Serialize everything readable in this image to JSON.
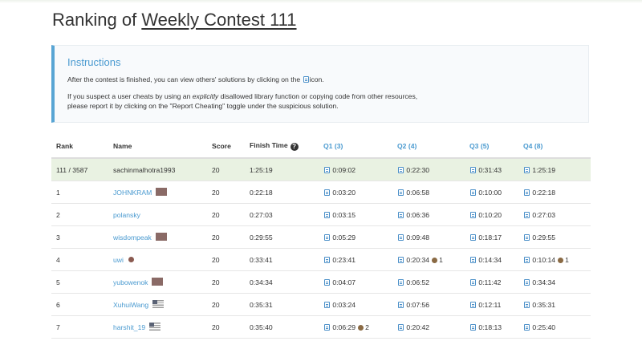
{
  "page": {
    "title_prefix": "Ranking of",
    "contest_name": "Weekly Contest 111"
  },
  "instructions": {
    "heading": "Instructions",
    "line1_a": "After the contest is finished, you can view others' solutions by clicking on the",
    "line1_b": "icon.",
    "line2_a": "If you suspect a user cheats by using an",
    "line2_em": "explicitly",
    "line2_b": "disallowed library function or copying code from other resources,",
    "line3": "please report it by clicking on the \"Report Cheating\" toggle under the suspicious solution."
  },
  "table": {
    "headers": {
      "rank": "Rank",
      "name": "Name",
      "score": "Score",
      "finish": "Finish Time",
      "q1": "Q1 (3)",
      "q2": "Q2 (4)",
      "q3": "Q3 (5)",
      "q4": "Q4 (8)"
    },
    "info_icon": "info-icon",
    "rows": [
      {
        "rank": "111 / 3587",
        "name": "sachinmalhotra1993",
        "flag": "",
        "score": "20",
        "finish": "1:25:19",
        "q1": "0:09:02",
        "q1_bugs": "",
        "q2": "0:22:30",
        "q2_bugs": "",
        "q3": "0:31:43",
        "q3_bugs": "",
        "q4": "1:25:19",
        "q4_bugs": ""
      },
      {
        "rank": "1",
        "name": "JOHNKRAM",
        "flag": "flag-icon",
        "score": "20",
        "finish": "0:22:18",
        "q1": "0:03:20",
        "q1_bugs": "",
        "q2": "0:06:58",
        "q2_bugs": "",
        "q3": "0:10:00",
        "q3_bugs": "",
        "q4": "0:22:18",
        "q4_bugs": ""
      },
      {
        "rank": "2",
        "name": "polansky",
        "flag": "",
        "score": "20",
        "finish": "0:27:03",
        "q1": "0:03:15",
        "q1_bugs": "",
        "q2": "0:06:36",
        "q2_bugs": "",
        "q3": "0:10:20",
        "q3_bugs": "",
        "q4": "0:27:03",
        "q4_bugs": ""
      },
      {
        "rank": "3",
        "name": "wisdompeak",
        "flag": "flag-icon",
        "score": "20",
        "finish": "0:29:55",
        "q1": "0:05:29",
        "q1_bugs": "",
        "q2": "0:09:48",
        "q2_bugs": "",
        "q3": "0:18:17",
        "q3_bugs": "",
        "q4": "0:29:55",
        "q4_bugs": ""
      },
      {
        "rank": "4",
        "name": "uwi",
        "flag": "dot-flag-icon",
        "score": "20",
        "finish": "0:33:41",
        "q1": "0:23:41",
        "q1_bugs": "",
        "q2": "0:20:34",
        "q2_bugs": "1",
        "q3": "0:14:34",
        "q3_bugs": "",
        "q4": "0:10:14",
        "q4_bugs": "1"
      },
      {
        "rank": "5",
        "name": "yubowenok",
        "flag": "flag-icon",
        "score": "20",
        "finish": "0:34:34",
        "q1": "0:04:07",
        "q1_bugs": "",
        "q2": "0:06:52",
        "q2_bugs": "",
        "q3": "0:11:42",
        "q3_bugs": "",
        "q4": "0:34:34",
        "q4_bugs": ""
      },
      {
        "rank": "6",
        "name": "XuhuiWang",
        "flag": "us-flag-icon",
        "score": "20",
        "finish": "0:35:31",
        "q1": "0:03:24",
        "q1_bugs": "",
        "q2": "0:07:56",
        "q2_bugs": "",
        "q3": "0:12:11",
        "q3_bugs": "",
        "q4": "0:35:31",
        "q4_bugs": ""
      },
      {
        "rank": "7",
        "name": "harshit_19",
        "flag": "us-flag-icon",
        "score": "20",
        "finish": "0:35:40",
        "q1": "0:06:29",
        "q1_bugs": "2",
        "q2": "0:20:42",
        "q2_bugs": "",
        "q3": "0:18:13",
        "q3_bugs": "",
        "q4": "0:25:40",
        "q4_bugs": ""
      }
    ]
  },
  "colors": {
    "accent": "#4a9ad0",
    "highlight_row": "#e9f2e2",
    "instructions_border": "#58a5d4"
  }
}
